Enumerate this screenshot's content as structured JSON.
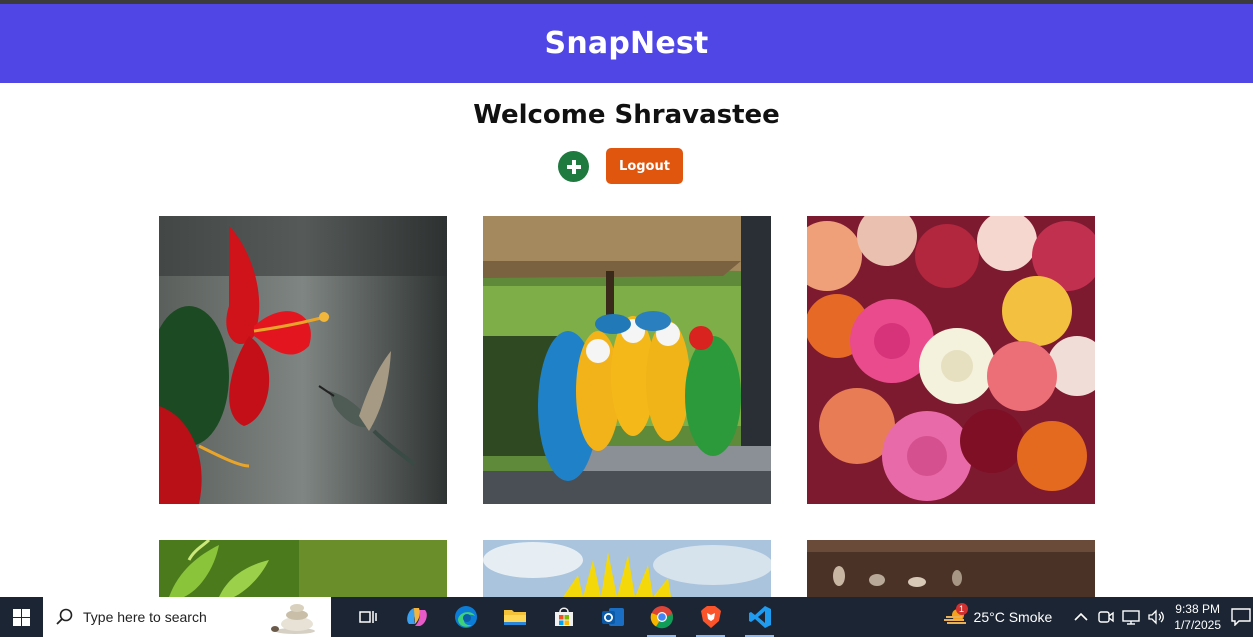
{
  "app": {
    "brand": "SnapNest",
    "welcome": "Welcome Shravastee",
    "logout_label": "Logout",
    "accent": "#4f46e5",
    "logout_color": "#e0560e",
    "add_color": "#1f7a3f"
  },
  "gallery": {
    "images": [
      {
        "subject": "hummingbird-hibiscus"
      },
      {
        "subject": "macaw-parrots"
      },
      {
        "subject": "roses-bouquet"
      },
      {
        "subject": "green-leaves"
      },
      {
        "subject": "sunflower-sky"
      },
      {
        "subject": "birds-field"
      }
    ]
  },
  "taskbar": {
    "search_placeholder": "Type here to search",
    "apps": [
      "task-view",
      "copilot",
      "edge",
      "file-explorer",
      "microsoft-store",
      "outlook",
      "chrome",
      "brave",
      "vscode"
    ],
    "active_apps": [
      "chrome",
      "brave",
      "vscode"
    ],
    "weather_badge": "1",
    "weather_text": "25°C  Smoke",
    "time": "9:38 PM",
    "date": "1/7/2025"
  }
}
